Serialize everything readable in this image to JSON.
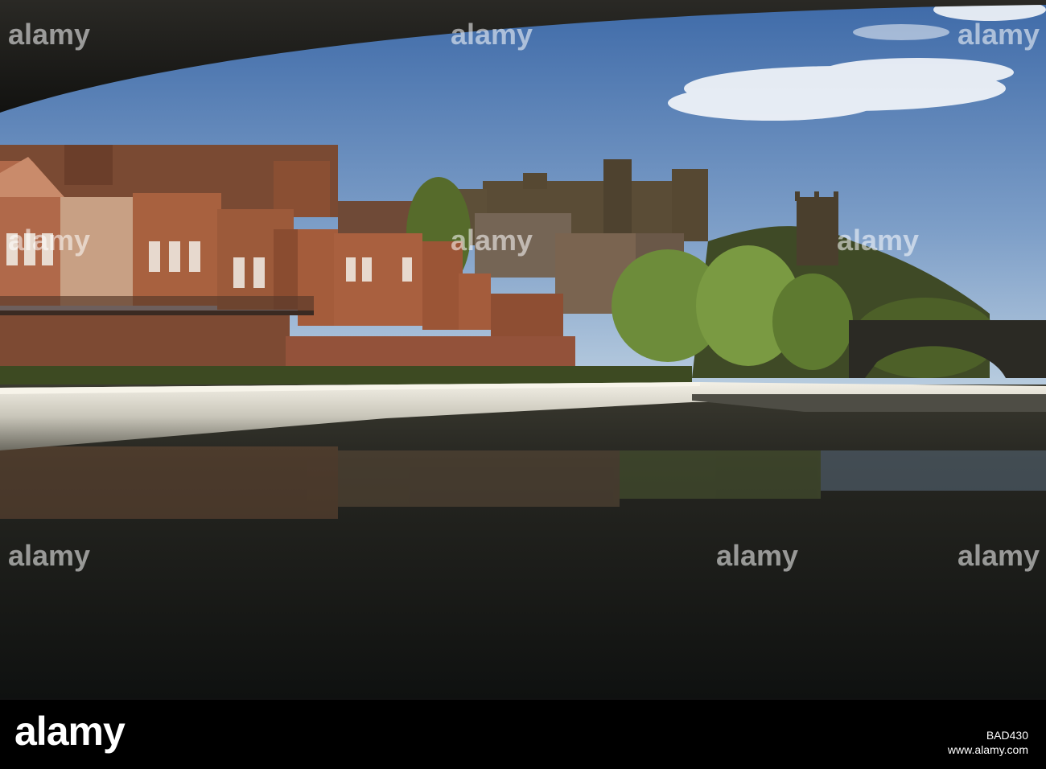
{
  "photo": {
    "subject": "",
    "colors": {
      "sky_top": "#3e6aa8",
      "sky_bottom": "#b8ccdf",
      "bridge_underside": "#1c1b17",
      "brick": "#a4633f",
      "brick_dark": "#6e3f28",
      "stone_cathedral": "#5f5038",
      "tree_green": "#6a8a3a",
      "weir_foam": "#e6e2d6",
      "river_dark": "#151715",
      "river_reflection": "#5a4a35"
    }
  },
  "watermarks": [
    {
      "id": "wm-1",
      "text": "alamy"
    },
    {
      "id": "wm-2",
      "text": "alamy"
    },
    {
      "id": "wm-3",
      "text": "alamy"
    },
    {
      "id": "wm-4",
      "text": "alamy"
    },
    {
      "id": "wm-5",
      "text": "alamy"
    },
    {
      "id": "wm-6",
      "text": "alamy"
    },
    {
      "id": "wm-7",
      "text": "alamy"
    },
    {
      "id": "wm-8",
      "text": "alamy"
    },
    {
      "id": "wm-9",
      "text": "alamy"
    }
  ],
  "footer": {
    "logo": "alamy",
    "image_code": "BAD430",
    "url": "www.alamy.com"
  }
}
